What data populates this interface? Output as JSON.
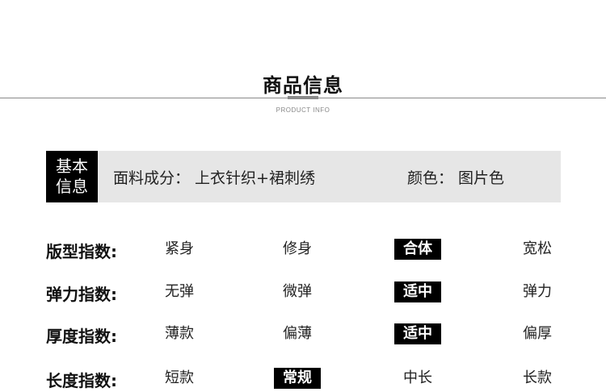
{
  "header": {
    "title": "商品信息",
    "subtitle": "PRODUCT INFO"
  },
  "basic": {
    "label_line1": "基本",
    "label_line2": "信息",
    "fabric": "面料成分：  上衣针织+裙刺绣",
    "color": "颜色：  图片色"
  },
  "indices": [
    {
      "label": "版型指数:",
      "options": [
        "紧身",
        "修身",
        "合体",
        "宽松"
      ],
      "selected": "合体"
    },
    {
      "label": "弹力指数:",
      "options": [
        "无弹",
        "微弹",
        "适中",
        "弹力"
      ],
      "selected": "适中"
    },
    {
      "label": "厚度指数:",
      "options": [
        "薄款",
        "偏薄",
        "适中",
        "偏厚"
      ],
      "selected": "适中"
    },
    {
      "label": "长度指数:",
      "options": [
        "短款",
        "常规",
        "中长",
        "长款"
      ],
      "selected": "常规"
    }
  ],
  "colors": {
    "highlight_bg": "#000000",
    "highlight_text": "#ffffff",
    "bar_bg": "#e6e6e6",
    "divider": "#8a8a8a"
  }
}
